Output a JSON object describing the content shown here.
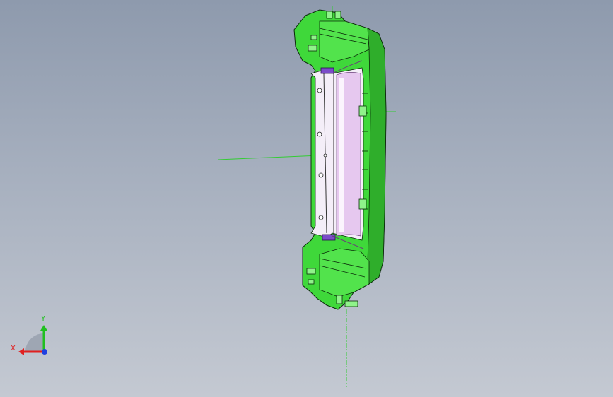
{
  "viewport": {
    "background_top": "#8e9aad",
    "background_bottom": "#c4c9d2"
  },
  "model": {
    "part_color": "#3fd83a",
    "part_dark": "#1f7a1c",
    "part_edge": "#0b2a0a",
    "inner_color": "#f4eef8",
    "inner_shade": "#d9b8e6",
    "clip_color": "#7b4cc9",
    "axis_line_color": "#33cc33"
  },
  "triad": {
    "x_label": "X",
    "y_label": "Y",
    "x_color": "#e02020",
    "y_color": "#20c020",
    "z_color": "#2040e0"
  }
}
